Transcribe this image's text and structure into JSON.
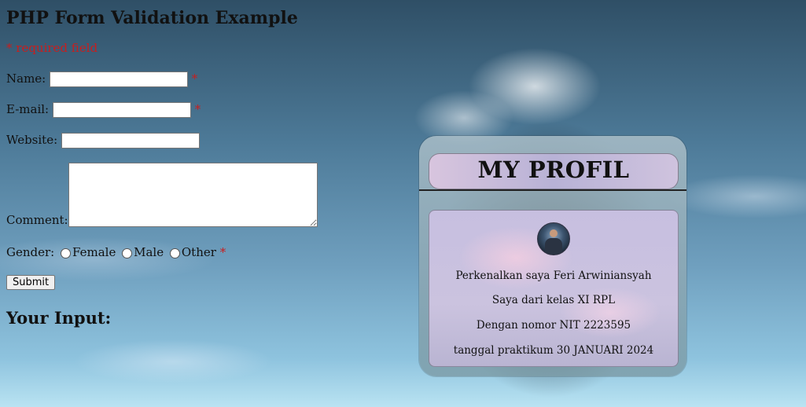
{
  "form": {
    "title": "PHP Form Validation Example",
    "required_note": "* required field",
    "name_label": "Name:",
    "email_label": "E-mail:",
    "website_label": "Website:",
    "comment_label": "Comment:",
    "gender_label": "Gender:",
    "gender_options": [
      "Female",
      "Male",
      "Other"
    ],
    "required_star": "*",
    "name_value": "",
    "email_value": "",
    "website_value": "",
    "comment_value": "",
    "submit_label": "Submit",
    "your_input_heading": "Your Input:"
  },
  "profile": {
    "title": "MY PROFIL",
    "lines": [
      "Perkenalkan saya Feri Arwiniansyah",
      "Saya dari kelas XI RPL",
      "Dengan nomor NIT 2223595",
      "tanggal praktikum 30 JANUARI 2024"
    ]
  }
}
